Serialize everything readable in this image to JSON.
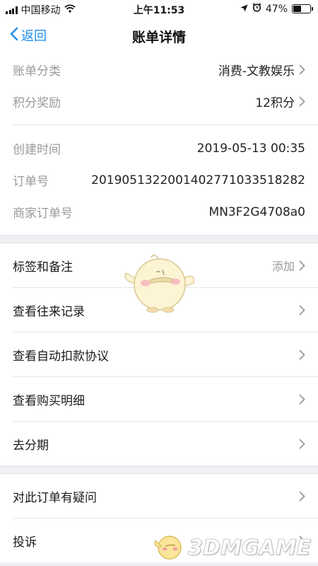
{
  "status_bar": {
    "carrier": "中国移动",
    "time": "上午11:53",
    "battery_percent": "47%",
    "battery_level": 0.47,
    "icons": [
      "signal-icon",
      "wifi-icon",
      "location-icon",
      "alarm-icon",
      "battery-icon"
    ]
  },
  "nav": {
    "back_label": "返回",
    "title": "账单详情"
  },
  "category": [
    {
      "label": "账单分类",
      "value": "消费-文教娱乐"
    },
    {
      "label": "积分奖励",
      "value": "12积分"
    }
  ],
  "details": [
    {
      "label": "创建时间",
      "value": "2019-05-13 00:35"
    },
    {
      "label": "订单号",
      "value": "20190513220014027710335182­82"
    },
    {
      "label": "商家订单号",
      "value": "MN3F2G4708a0"
    }
  ],
  "actions": {
    "tags": {
      "label": "标签和备注",
      "value": "添加"
    },
    "items": [
      {
        "label": "查看往来记录"
      },
      {
        "label": "查看自动扣款协议"
      },
      {
        "label": "查看购买明细"
      },
      {
        "label": "去分期"
      }
    ]
  },
  "support": {
    "items": [
      {
        "label": "对此订单有疑问"
      },
      {
        "label": "投诉"
      }
    ]
  },
  "watermark": {
    "text": "3DMGAME"
  },
  "colors": {
    "accent": "#1a8cf0",
    "label_gray": "#999999",
    "background": "#efeff4"
  }
}
